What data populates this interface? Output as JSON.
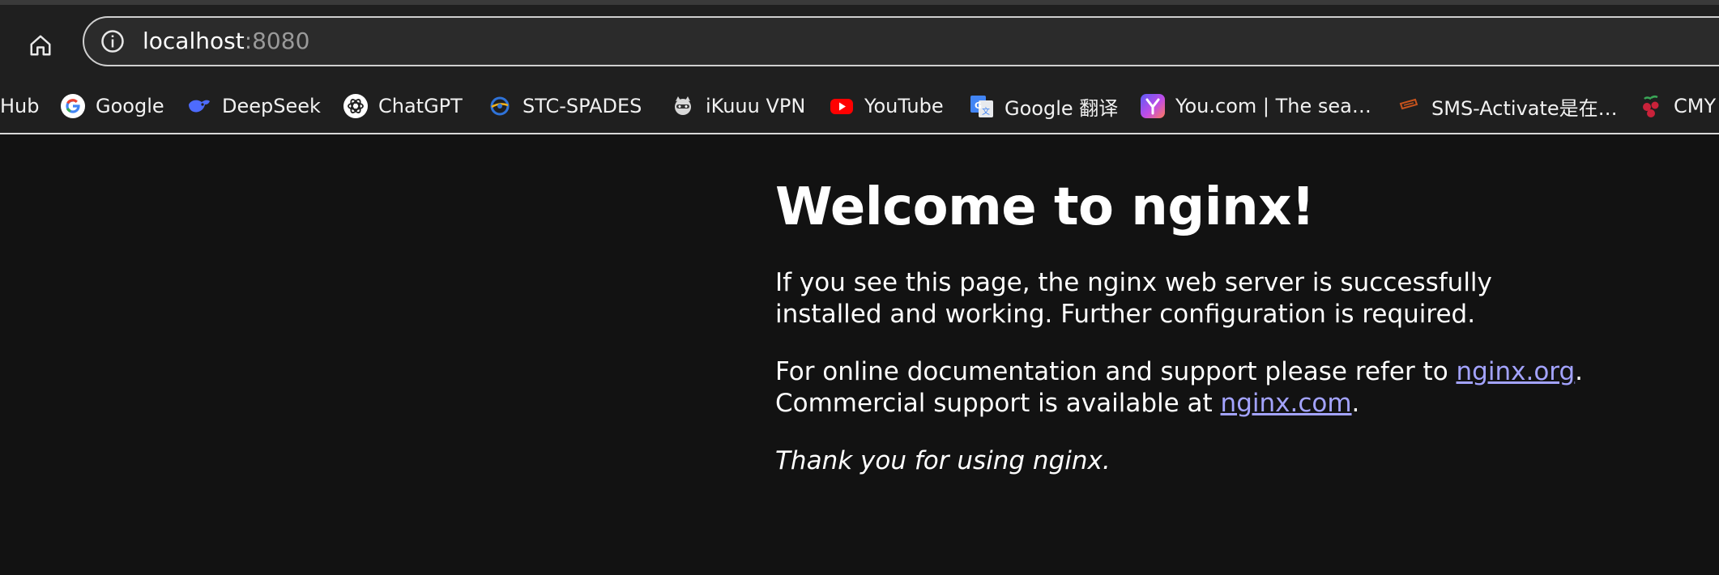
{
  "browser": {
    "url_host": "localhost",
    "url_port": ":8080",
    "bookmarks": [
      {
        "label": "Hub",
        "icon": "github-icon"
      },
      {
        "label": "Google",
        "icon": "google-icon"
      },
      {
        "label": "DeepSeek",
        "icon": "deepseek-icon"
      },
      {
        "label": "ChatGPT",
        "icon": "chatgpt-icon"
      },
      {
        "label": "STC-SPADES",
        "icon": "stc-spades-icon"
      },
      {
        "label": "iKuuu VPN",
        "icon": "ikuuu-vpn-icon"
      },
      {
        "label": "YouTube",
        "icon": "youtube-icon"
      },
      {
        "label": "Google 翻译",
        "icon": "google-translate-icon"
      },
      {
        "label": "You.com | The sea…",
        "icon": "you-com-icon"
      },
      {
        "label": "SMS-Activate是在…",
        "icon": "sms-activate-icon"
      },
      {
        "label": "CMY",
        "icon": "cmy-icon"
      }
    ]
  },
  "page": {
    "heading": "Welcome to nginx!",
    "p1": "If you see this page, the nginx web server is successfully installed and working. Further configuration is required.",
    "p2_before": "For online documentation and support please refer to ",
    "link_org": "nginx.org",
    "p2_mid": ".",
    "p2_line2": "Commercial support is available at ",
    "link_com": "nginx.com",
    "p2_end": ".",
    "p3": "Thank you for using nginx."
  },
  "colors": {
    "background": "#121212",
    "chrome": "#1f1f1f",
    "link": "#a3a3ff"
  }
}
